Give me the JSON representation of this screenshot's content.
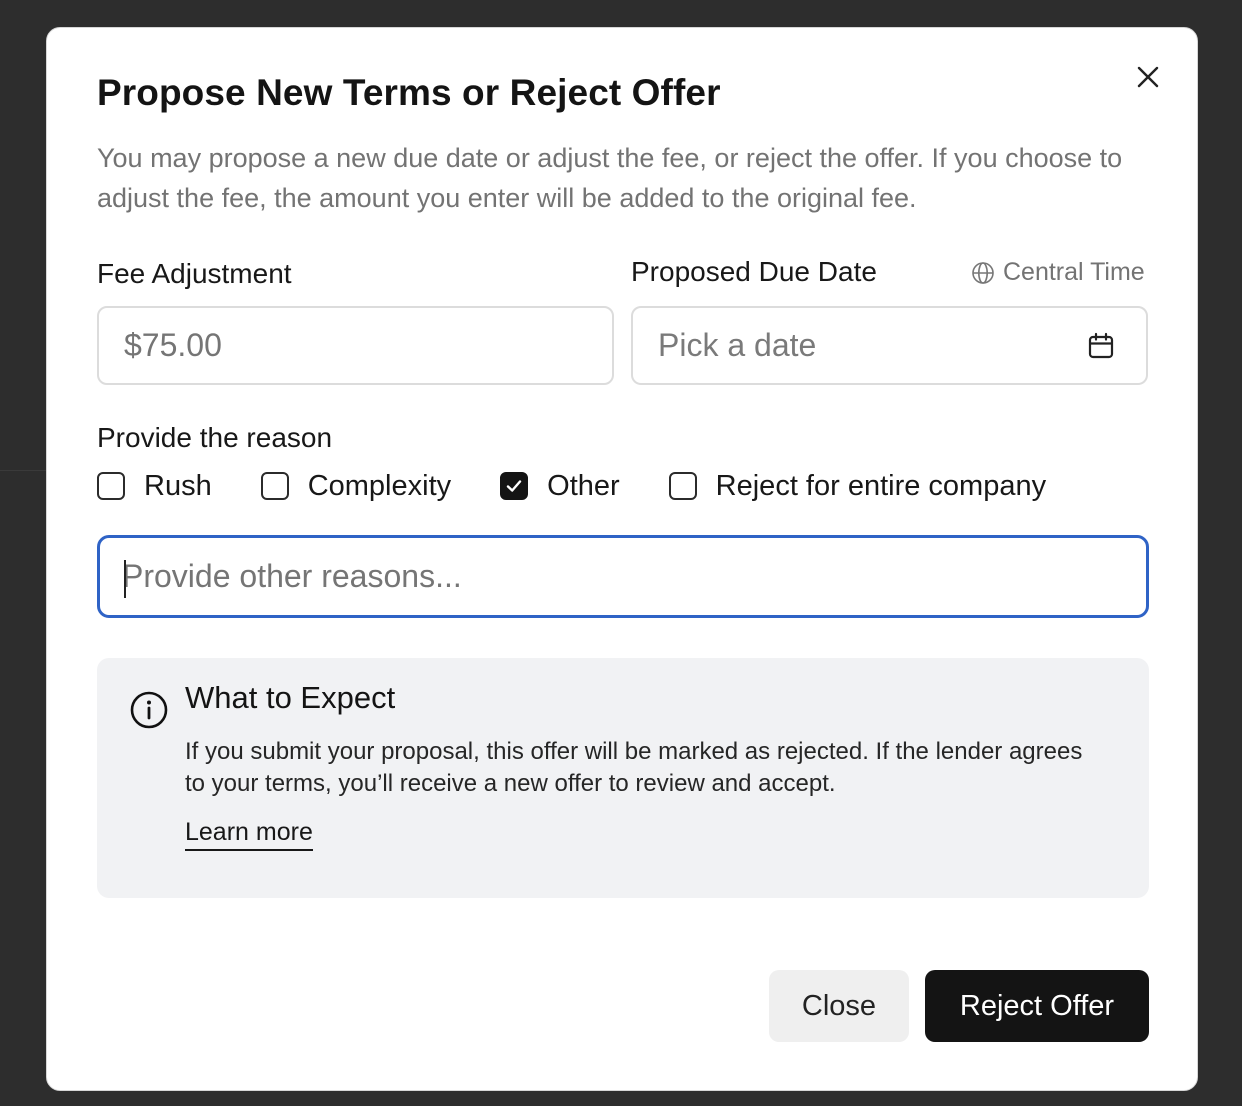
{
  "dialog": {
    "title": "Propose New Terms or Reject Offer",
    "description": "You may propose a new due date or adjust the fee, or reject the offer. If you choose to adjust the fee, the amount you enter will be added to the original fee."
  },
  "fee": {
    "label": "Fee Adjustment",
    "placeholder": "$75.00"
  },
  "due_date": {
    "label": "Proposed Due Date",
    "timezone": "Central Time",
    "placeholder": "Pick a date"
  },
  "reason": {
    "title": "Provide the reason",
    "options": [
      {
        "label": "Rush",
        "checked": false
      },
      {
        "label": "Complexity",
        "checked": false
      },
      {
        "label": "Other",
        "checked": true
      },
      {
        "label": "Reject for entire company",
        "checked": false
      }
    ],
    "other_placeholder": "Provide other reasons..."
  },
  "info": {
    "title": "What to Expect",
    "body": "If you submit your proposal, this offer will be marked as rejected. If the lender agrees to your terms, you’ll receive a new offer to review and accept.",
    "link": "Learn more"
  },
  "footer": {
    "close_label": "Close",
    "reject_label": "Reject Offer"
  },
  "colors": {
    "focus_border": "#2f63c6",
    "primary_button": "#141414",
    "info_background": "#f1f2f4"
  }
}
